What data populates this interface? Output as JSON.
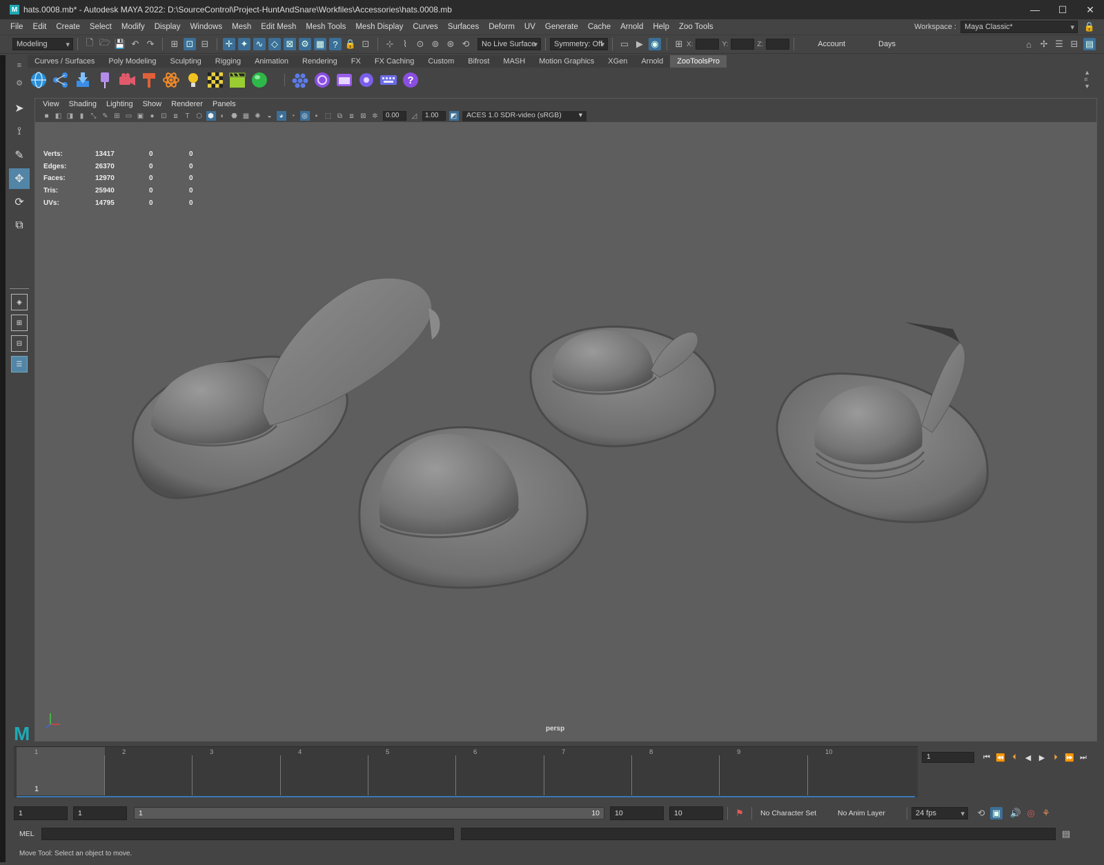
{
  "window": {
    "title": "hats.0008.mb* - Autodesk MAYA 2022: D:\\SourceControl\\Project-HuntAndSnare\\Workfiles\\Accessories\\hats.0008.mb",
    "app_icon": "M",
    "controls": [
      "—",
      "☐",
      "✕"
    ]
  },
  "menubar": {
    "items": [
      "File",
      "Edit",
      "Create",
      "Select",
      "Modify",
      "Display",
      "Windows",
      "Mesh",
      "Edit Mesh",
      "Mesh Tools",
      "Mesh Display",
      "Curves",
      "Surfaces",
      "Deform",
      "UV",
      "Generate",
      "Cache",
      "Arnold",
      "Help",
      "Zoo Tools"
    ],
    "workspace_label": "Workspace :",
    "workspace_value": "Maya Classic*"
  },
  "statusline": {
    "menuset": "Modeling",
    "live_surface": "No Live Surface",
    "symmetry": "Symmetry: Off",
    "x_label": "X:",
    "y_label": "Y:",
    "z_label": "Z:",
    "account": "Account",
    "days": "Days"
  },
  "shelf": {
    "tabs": [
      "Curves / Surfaces",
      "Poly Modeling",
      "Sculpting",
      "Rigging",
      "Animation",
      "Rendering",
      "FX",
      "FX Caching",
      "Custom",
      "Bifrost",
      "MASH",
      "Motion Graphics",
      "XGen",
      "Arnold",
      "ZooToolsPro"
    ],
    "active_tab": "ZooToolsPro",
    "icons": [
      {
        "name": "globe-icon",
        "color": "#2a8fd6"
      },
      {
        "name": "nodes-icon",
        "color": "#3a8ee8"
      },
      {
        "name": "download-icon",
        "color": "#3a8ee8"
      },
      {
        "name": "pin-icon",
        "color": "#b38be8"
      },
      {
        "name": "camera-icon",
        "color": "#e05a6a"
      },
      {
        "name": "hammer-icon",
        "color": "#e0603a"
      },
      {
        "name": "atom-icon",
        "color": "#f08a2a"
      },
      {
        "name": "bulb-icon",
        "color": "#f2c320"
      },
      {
        "name": "checker-icon",
        "color": "#e8d040"
      },
      {
        "name": "clapper-icon",
        "color": "#9acd32"
      },
      {
        "name": "sphere-icon",
        "color": "#2fb84a"
      },
      {
        "name": "hex-icon",
        "color": "#5b7be8"
      },
      {
        "name": "swirl-icon",
        "color": "#8a4fe0"
      },
      {
        "name": "window-icon",
        "color": "#9a5fe8"
      },
      {
        "name": "gear-icon",
        "color": "#7a5fe8"
      },
      {
        "name": "keyboard-icon",
        "color": "#6b6be8"
      },
      {
        "name": "help-icon",
        "color": "#8a4fe0"
      }
    ]
  },
  "panel": {
    "menus": [
      "View",
      "Shading",
      "Lighting",
      "Show",
      "Renderer",
      "Panels"
    ],
    "exposure": "0.00",
    "gamma": "1.00",
    "colorspace": "ACES 1.0 SDR-video (sRGB)",
    "camera": "persp",
    "hud": [
      {
        "label": "Verts:",
        "v1": "13417",
        "v2": "0",
        "v3": "0"
      },
      {
        "label": "Edges:",
        "v1": "26370",
        "v2": "0",
        "v3": "0"
      },
      {
        "label": "Faces:",
        "v1": "12970",
        "v2": "0",
        "v3": "0"
      },
      {
        "label": "Tris:",
        "v1": "25940",
        "v2": "0",
        "v3": "0"
      },
      {
        "label": "UVs:",
        "v1": "14795",
        "v2": "0",
        "v3": "0"
      }
    ]
  },
  "timeline": {
    "frames": [
      "1",
      "2",
      "3",
      "4",
      "5",
      "6",
      "7",
      "8",
      "9",
      "10"
    ],
    "current_frame": "1",
    "current_frame_field": "1"
  },
  "range": {
    "start": "1",
    "playback_start": "1",
    "slider_start": "1",
    "slider_end": "10",
    "playback_end": "10",
    "end": "10",
    "character_set": "No Character Set",
    "anim_layer": "No Anim Layer",
    "fps": "24 fps"
  },
  "cmd": {
    "mel_label": "MEL",
    "help_text": "Move Tool: Select an object to move."
  },
  "colors": {
    "accent_blue": "#3c6f98",
    "viewport_bg": "#5e5e5e",
    "maya_teal": "#1fa9b5"
  }
}
